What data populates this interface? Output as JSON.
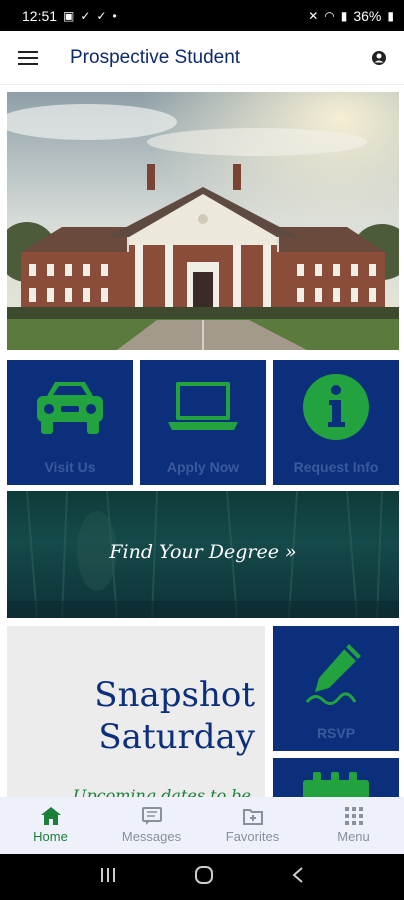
{
  "status_bar": {
    "time": "12:51",
    "battery": "36%"
  },
  "app_bar": {
    "title": "Prospective Student"
  },
  "tiles": [
    {
      "label": "Visit Us",
      "icon": "car-icon"
    },
    {
      "label": "Apply Now",
      "icon": "laptop-icon"
    },
    {
      "label": "Request Info",
      "icon": "info-icon"
    }
  ],
  "degree_banner": {
    "text": "Find Your Degree »"
  },
  "snapshot": {
    "title_line1": "Snapshot",
    "title_line2": "Saturday",
    "subtitle": "Upcoming dates to be"
  },
  "rsvp_tile": {
    "label": "RSVP",
    "icon": "pen-signature-icon"
  },
  "bottom_nav": {
    "items": [
      {
        "label": "Home",
        "icon": "home-icon",
        "active": true
      },
      {
        "label": "Messages",
        "icon": "messages-icon",
        "active": false
      },
      {
        "label": "Favorites",
        "icon": "favorites-icon",
        "active": false
      },
      {
        "label": "Menu",
        "icon": "grid-menu-icon",
        "active": false
      }
    ]
  },
  "colors": {
    "primary_blue": "#0b2f7b",
    "accent_green": "#1b7f3a"
  }
}
